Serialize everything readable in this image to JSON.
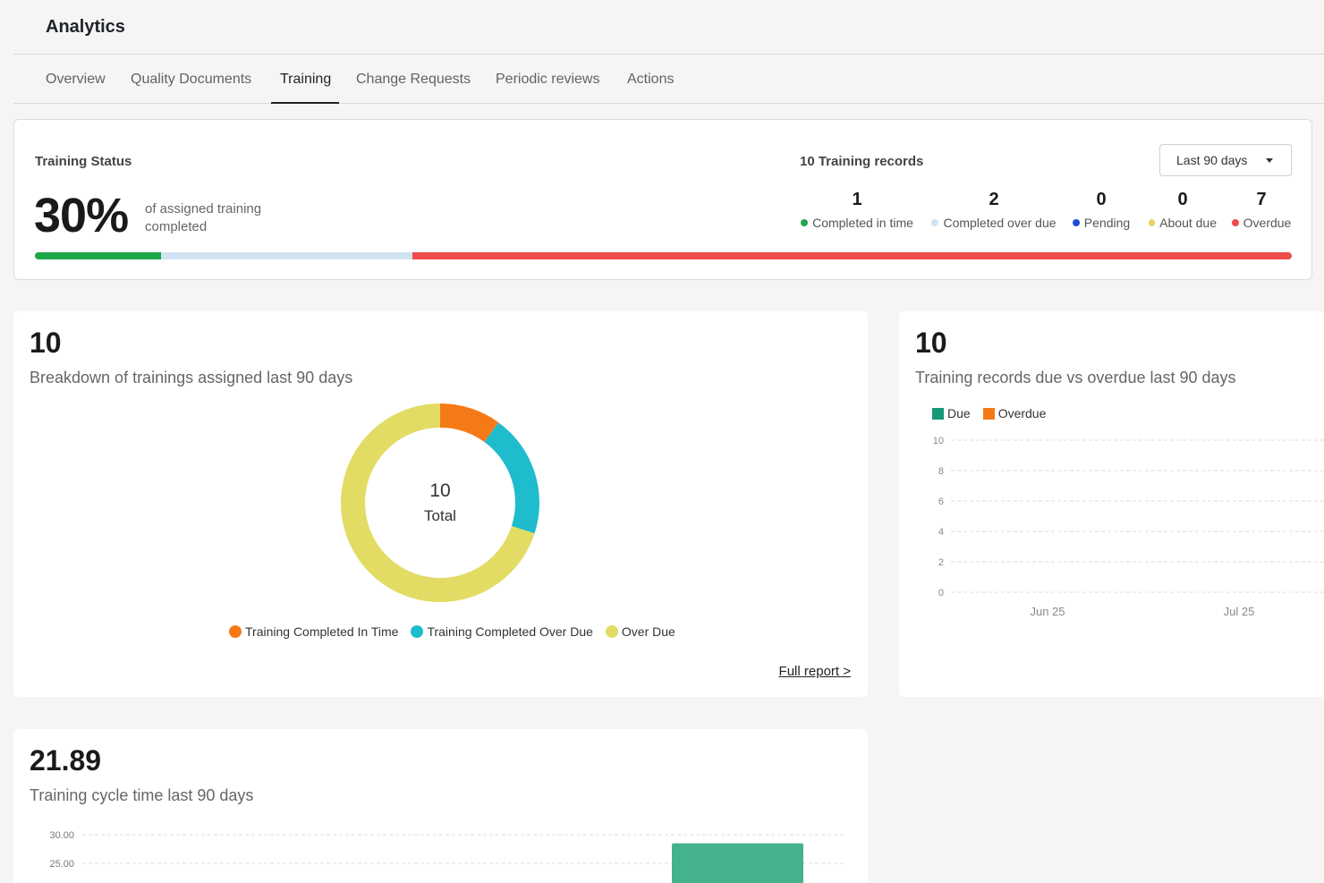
{
  "header": {
    "title": "Analytics"
  },
  "tabs": [
    {
      "label": "Overview"
    },
    {
      "label": "Quality Documents"
    },
    {
      "label": "Training",
      "active": true
    },
    {
      "label": "Change Requests"
    },
    {
      "label": "Periodic reviews"
    },
    {
      "label": "Actions"
    }
  ],
  "status": {
    "label": "Training Status",
    "percent": "30%",
    "caption": "of assigned training completed",
    "records_title": "10 Training records",
    "range": "Last 90 days",
    "stats": [
      {
        "value": "1",
        "label": "Completed in time",
        "color": "#1ea64a"
      },
      {
        "value": "2",
        "label": "Completed over due",
        "color": "#cfe3f2"
      },
      {
        "value": "0",
        "label": "Pending",
        "color": "#1a4fd6"
      },
      {
        "value": "0",
        "label": "About due",
        "color": "#e8d262"
      },
      {
        "value": "7",
        "label": "Overdue",
        "color": "#ee4b4b"
      }
    ]
  },
  "breakdown": {
    "number": "10",
    "subtitle": "Breakdown of trainings assigned last 90 days",
    "center_value": "10",
    "center_label": "Total",
    "full_report": "Full report >"
  },
  "due_card": {
    "number": "10",
    "subtitle": "Training records due vs overdue last 90 days"
  },
  "cycle_card": {
    "number": "21.89",
    "subtitle": "Training cycle time last 90 days"
  },
  "chart_data": [
    {
      "type": "pie",
      "categories": [
        "Training Completed In Time",
        "Training Completed Over Due",
        "Over Due"
      ],
      "values": [
        1,
        2,
        7
      ],
      "colors": [
        "#f57a17",
        "#1ebccc",
        "#e2dc64"
      ],
      "legend": "bottom"
    },
    {
      "type": "bar",
      "categories": [
        "Jun 25",
        "Jul 25"
      ],
      "series": [
        {
          "name": "Due",
          "values": [
            0,
            0
          ],
          "color": "#139a77"
        },
        {
          "name": "Overdue",
          "values": [
            0,
            0
          ],
          "color": "#f57a17"
        }
      ],
      "yticks": [
        "10",
        "8",
        "6",
        "4",
        "2",
        "0"
      ],
      "ylim": [
        0,
        10
      ],
      "grid": true,
      "legend": "top-left"
    },
    {
      "type": "bar",
      "categories": [
        "",
        ""
      ],
      "values": [
        0,
        28.5
      ],
      "color": "#44b38b",
      "yticks": [
        "30.00",
        "25.00"
      ],
      "grid": true
    }
  ]
}
